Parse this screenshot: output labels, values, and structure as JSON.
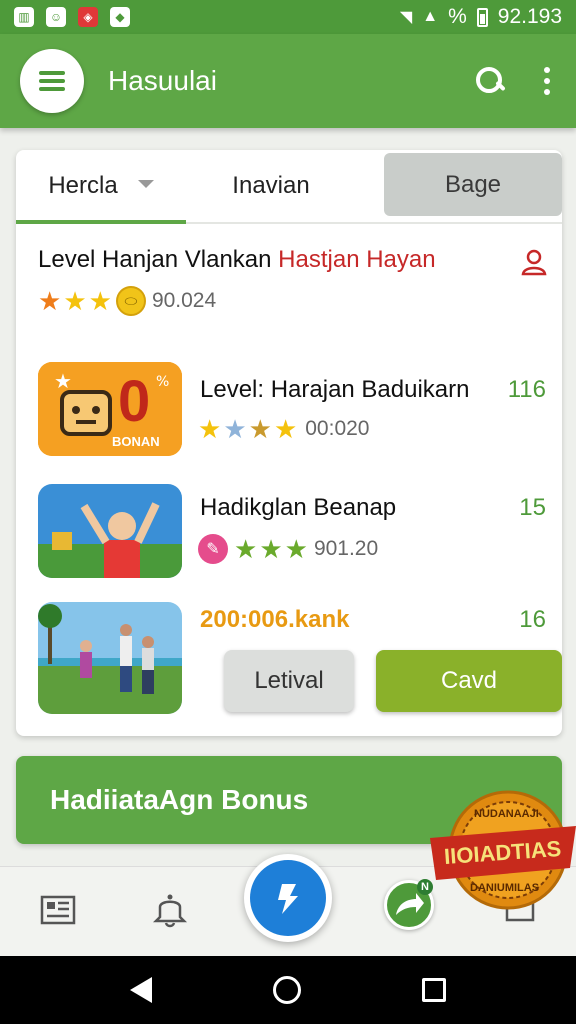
{
  "status_bar": {
    "battery_text": "%",
    "time": "92.193"
  },
  "app_bar": {
    "title": "Hasuulai"
  },
  "tabs": [
    {
      "label": "Hercla",
      "active": true,
      "has_dropdown": true
    },
    {
      "label": "Inavian",
      "active": false
    },
    {
      "label": "Bage",
      "active": false,
      "filled": true
    }
  ],
  "header": {
    "title_main": "Level Hanjan Vlankan ",
    "title_accent": "Hastjan Hayan",
    "rating_value": "90.024"
  },
  "items": [
    {
      "title": "Level: Harajan Baduikarn",
      "count": "116",
      "meta_value": "00:020",
      "thumb_text": "0",
      "thumb_caption": "BONAN"
    },
    {
      "title": "Hadikglan Beanap",
      "count": "15",
      "meta_value": "901.20"
    },
    {
      "title": "200:006.kank",
      "count": "16"
    }
  ],
  "buttons": {
    "secondary": "Letival",
    "primary": "Cavd"
  },
  "banner": {
    "text": "HadiiataAgn Bonus"
  },
  "seal": {
    "top_text": "NUDANAAJI",
    "mid_text": "IIOIADTIAS",
    "bottom_text": "DANIUMILAS"
  },
  "share_badge": "N",
  "colors": {
    "primary_green": "#5ea746",
    "accent_red": "#c62828",
    "fab_blue": "#1e7fd8",
    "button_green": "#8ab12a"
  },
  "icons": [
    "menu-icon",
    "search-icon",
    "more-vert-icon",
    "user-icon",
    "news-icon",
    "bell-icon",
    "bolt-icon",
    "share-icon",
    "back-icon",
    "home-icon",
    "recents-icon"
  ]
}
